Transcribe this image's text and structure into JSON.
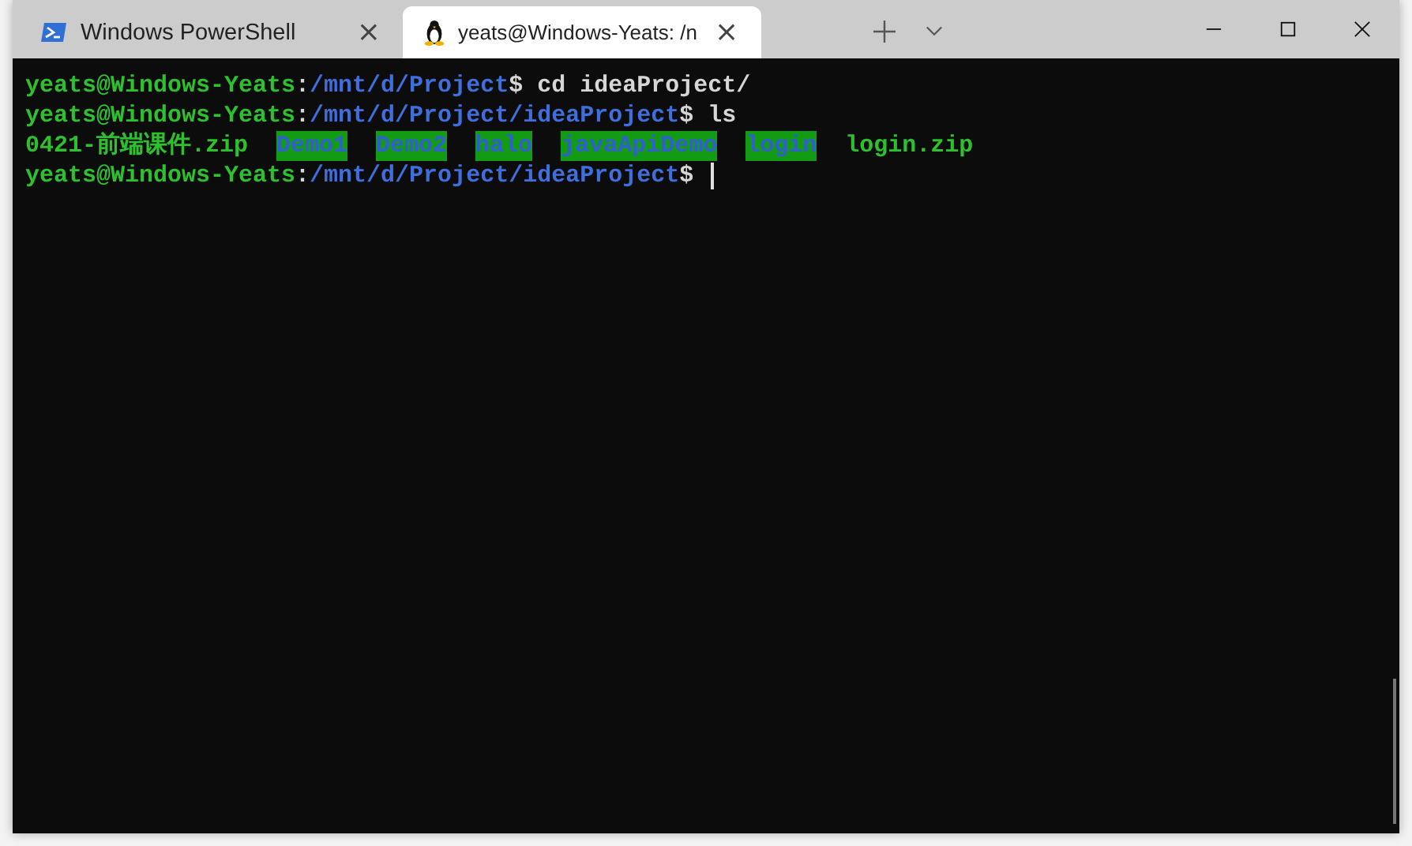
{
  "tabs": [
    {
      "title": "Windows PowerShell",
      "kind": "powershell",
      "selected": false,
      "close": "×"
    },
    {
      "title": "yeats@Windows-Yeats: /n",
      "kind": "linux",
      "selected": true,
      "close": "×"
    }
  ],
  "terminal": {
    "lines": [
      [
        {
          "kind": "user",
          "text": "yeats@Windows-Yeats"
        },
        {
          "kind": "plain",
          "text": ":"
        },
        {
          "kind": "path",
          "text": "/mnt/d/Project"
        },
        {
          "kind": "plain",
          "text": "$ cd ideaProject/"
        }
      ],
      [
        {
          "kind": "user",
          "text": "yeats@Windows-Yeats"
        },
        {
          "kind": "plain",
          "text": ":"
        },
        {
          "kind": "path",
          "text": "/mnt/d/Project/ideaProject"
        },
        {
          "kind": "plain",
          "text": "$ ls"
        }
      ],
      [
        {
          "kind": "file",
          "text": "0421-前端课件.zip"
        },
        {
          "kind": "dir",
          "text": "Demo1"
        },
        {
          "kind": "dir",
          "text": "Demo2"
        },
        {
          "kind": "dir",
          "text": "halo"
        },
        {
          "kind": "dir",
          "text": "javaApiDemo"
        },
        {
          "kind": "dir",
          "text": "login"
        },
        {
          "kind": "file",
          "text": "login.zip"
        }
      ],
      [
        {
          "kind": "user",
          "text": "yeats@Windows-Yeats"
        },
        {
          "kind": "plain",
          "text": ":"
        },
        {
          "kind": "path",
          "text": "/mnt/d/Project/ideaProject"
        },
        {
          "kind": "plain",
          "text": "$ "
        },
        {
          "kind": "cursor"
        }
      ]
    ]
  }
}
